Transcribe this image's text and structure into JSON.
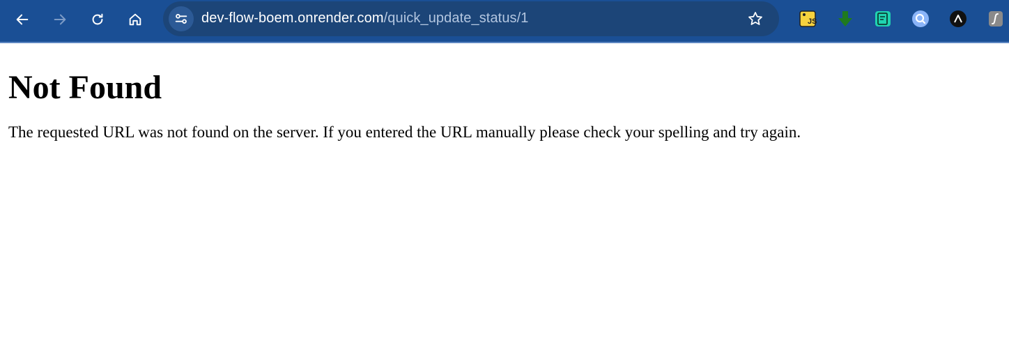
{
  "browser": {
    "url_host": "dev-flow-boem.onrender.com",
    "url_path": "/quick_update_status/1",
    "toolbar_color": "#1a4f95",
    "omnibox_color": "#1c4578",
    "nav_icons": [
      "back-arrow-icon",
      "forward-arrow-icon",
      "reload-icon",
      "home-icon"
    ],
    "site_info_icon": "tune-icon",
    "bookmark_icon": "star-icon",
    "extensions": [
      {
        "name": "js-extension",
        "text": "JS",
        "color": "#f7d23e"
      },
      {
        "name": "download-extension",
        "color": "#1f7a1f"
      },
      {
        "name": "notes-extension",
        "color": "#20d3b0"
      },
      {
        "name": "search-extension",
        "color": "#8ab4f8"
      },
      {
        "name": "delta-extension",
        "text": "Λ",
        "color": "#111111"
      },
      {
        "name": "script-extension",
        "text": "ʃ",
        "color": "#8a8a8a"
      }
    ]
  },
  "page": {
    "heading": "Not Found",
    "message": "The requested URL was not found on the server. If you entered the URL manually please check your spelling and try again."
  }
}
